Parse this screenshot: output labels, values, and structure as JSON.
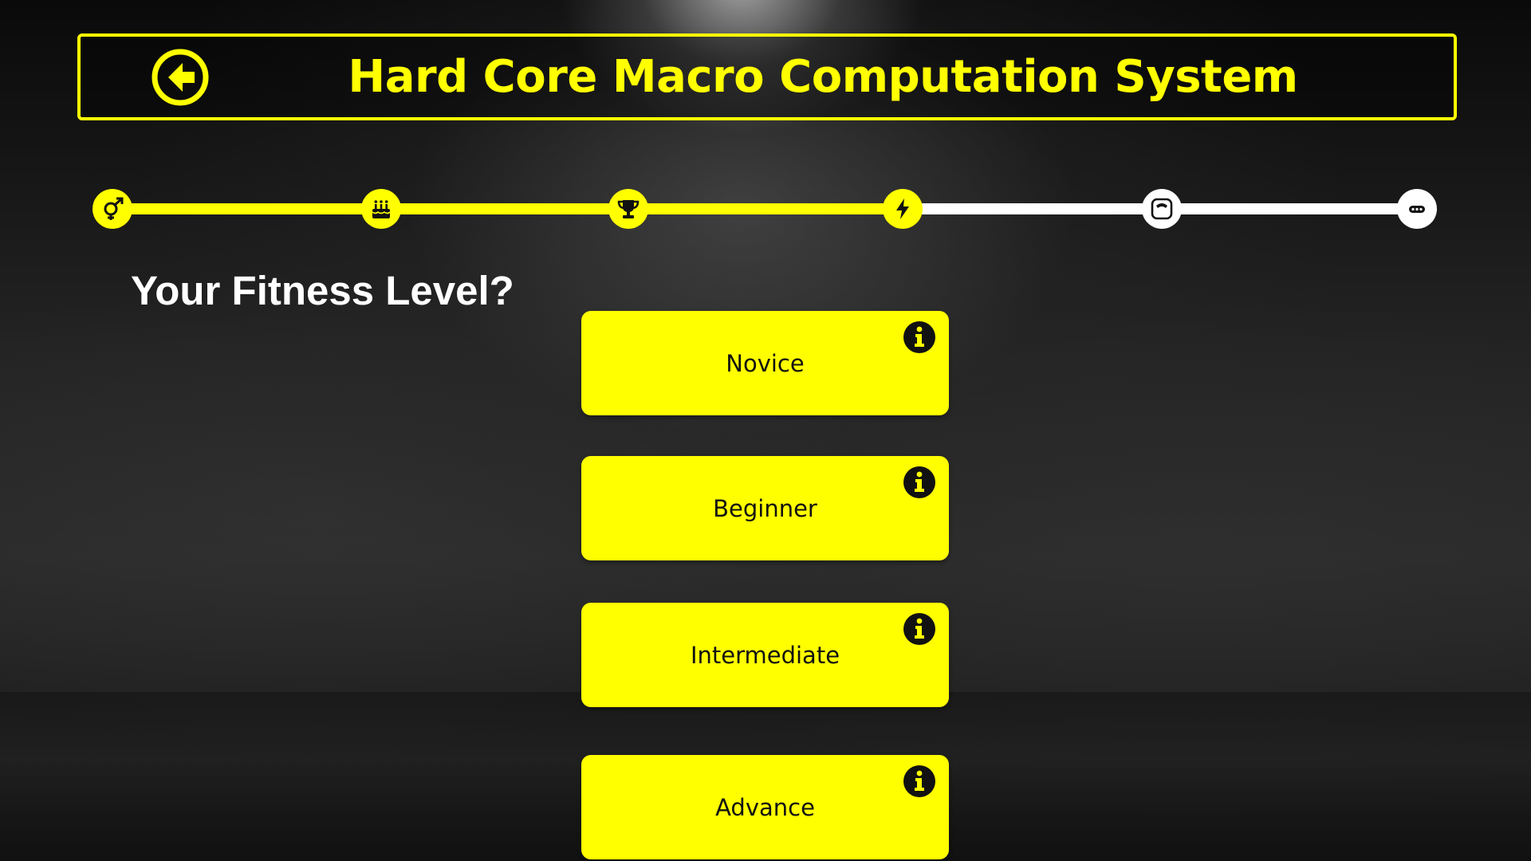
{
  "header": {
    "title": "Hard Core Macro Computation System",
    "back_icon": "arrow-left-circle-icon"
  },
  "progress": {
    "steps": [
      {
        "icon": "gender-icon",
        "state": "done"
      },
      {
        "icon": "birthday-cake-icon",
        "state": "done"
      },
      {
        "icon": "trophy-icon",
        "state": "done"
      },
      {
        "icon": "lightning-icon",
        "state": "current"
      },
      {
        "icon": "weight-scale-icon",
        "state": "todo"
      },
      {
        "icon": "more-dots-icon",
        "state": "todo"
      }
    ],
    "completed_fraction": 0.6
  },
  "question": "Your Fitness Level?",
  "options": [
    {
      "label": "Novice",
      "icon": "info-icon"
    },
    {
      "label": "Beginner",
      "icon": "info-icon"
    },
    {
      "label": "Intermediate",
      "icon": "info-icon"
    },
    {
      "label": "Advance",
      "icon": "info-icon"
    }
  ],
  "colors": {
    "accent": "#ffff00",
    "text_dark": "#111111",
    "text_light": "#ffffff",
    "inactive_track": "#ffffff"
  }
}
